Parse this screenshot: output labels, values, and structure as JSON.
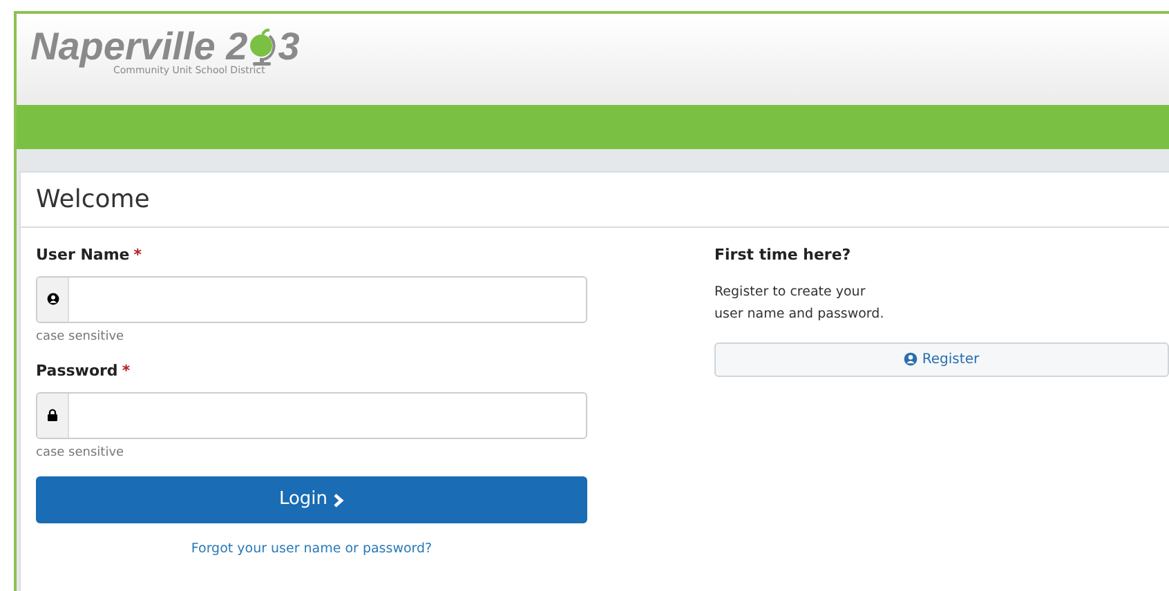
{
  "logo": {
    "wordmark": "Naperville 2",
    "wordmark_end": "3",
    "tagline": "Community Unit School District"
  },
  "title": "Welcome",
  "fields": [
    {
      "label": "User Name",
      "required_mark": "*",
      "kind": "user",
      "hint": "case sensitive"
    },
    {
      "label": "Password",
      "required_mark": "*",
      "kind": "lock",
      "hint": "case sensitive"
    }
  ],
  "login_button": {
    "label": "Login"
  },
  "forgot_link": "Forgot your user name or password?",
  "register": {
    "heading": "First time here?",
    "text": "Register to create your\nuser name and password.",
    "button": "Register"
  }
}
